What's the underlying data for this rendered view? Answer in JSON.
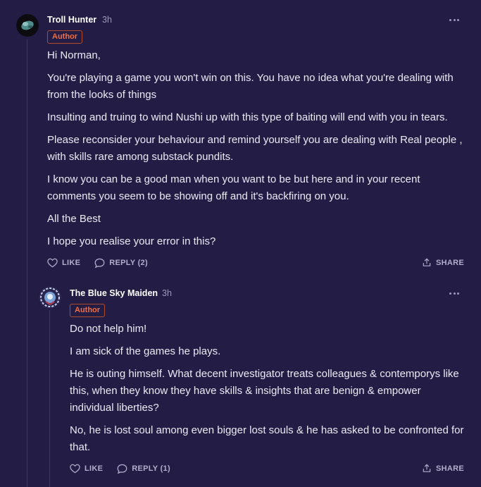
{
  "colors": {
    "background": "#231d45",
    "badge_border": "#b04b2c",
    "badge_text": "#f26d3f",
    "muted": "#9e98bb",
    "action": "#b3adcd"
  },
  "comments": [
    {
      "author": "Troll Hunter",
      "time": "3h",
      "badge": "Author",
      "paragraphs": [
        "Hi Norman,",
        "You're playing a game you won't win on this. You have no idea what you're dealing with from the looks of things",
        "Insulting and truing to wind Nushi up with this type of baiting will end with you in tears.",
        "Please reconsider your behaviour and remind yourself you are dealing with Real people , with skills rare among substack pundits.",
        "I know you can be a good man when you want to be but here and in your recent comments you seem to be showing off and it's backfiring on you.",
        "All the Best",
        "I hope you realise your error in this?"
      ],
      "like_label": "LIKE",
      "reply_label": "REPLY (2)",
      "share_label": "SHARE"
    },
    {
      "author": "The Blue Sky Maiden",
      "time": "3h",
      "badge": "Author",
      "paragraphs": [
        "Do not help him!",
        "I am sick of the games he plays.",
        "He is outing himself. What decent investigator treats colleagues & contemporys like this, when they know they have skills & insights that are benign & empower individual liberties?",
        "No, he is lost soul among even bigger lost souls & he has asked to be confronted for that."
      ],
      "like_label": "LIKE",
      "reply_label": "REPLY (1)",
      "share_label": "SHARE"
    }
  ]
}
